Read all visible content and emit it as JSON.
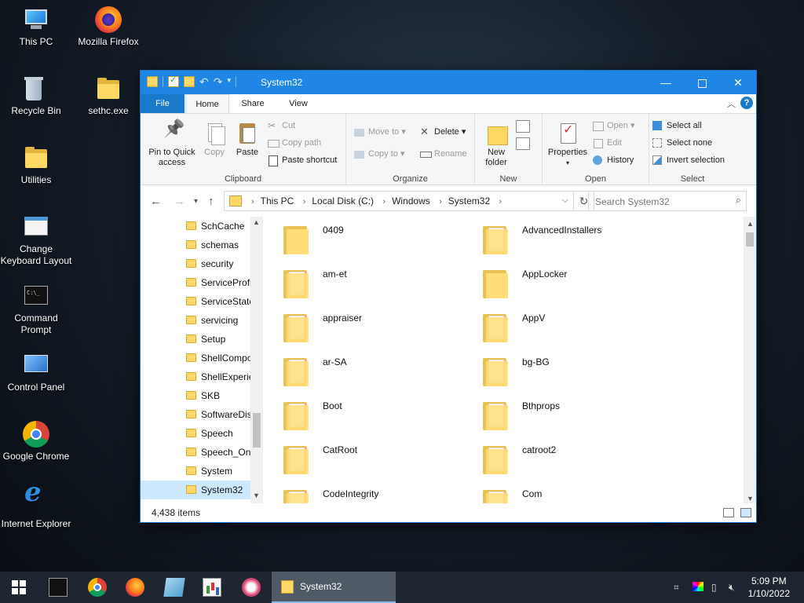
{
  "desktop": {
    "icons": [
      {
        "label": "This PC",
        "icon": "computer-icon"
      },
      {
        "label": "Mozilla Firefox",
        "icon": "firefox-icon"
      },
      {
        "label": "Recycle Bin",
        "icon": "recycle-bin-icon"
      },
      {
        "label": "sethc.exe",
        "icon": "folder-app-icon"
      },
      {
        "label": "Utilities",
        "icon": "folder-icon"
      },
      {
        "label": "Change Keyboard Layout",
        "icon": "keyboard-settings-icon"
      },
      {
        "label": "Command Prompt",
        "icon": "command-prompt-icon"
      },
      {
        "label": "Control Panel",
        "icon": "control-panel-icon"
      },
      {
        "label": "Google Chrome",
        "icon": "chrome-icon"
      },
      {
        "label": "Internet Explorer",
        "icon": "internet-explorer-icon"
      }
    ]
  },
  "window": {
    "title": "System32",
    "tabs": {
      "file": "File",
      "home": "Home",
      "share": "Share",
      "view": "View"
    },
    "ribbon": {
      "clipboard": {
        "label": "Clipboard",
        "pin": "Pin to Quick access",
        "copy": "Copy",
        "paste": "Paste",
        "cut": "Cut",
        "copy_path": "Copy path",
        "paste_shortcut": "Paste shortcut"
      },
      "organize": {
        "label": "Organize",
        "move_to": "Move to",
        "copy_to": "Copy to",
        "delete": "Delete",
        "rename": "Rename"
      },
      "new": {
        "label": "New",
        "new_folder": "New folder"
      },
      "open": {
        "label": "Open",
        "properties": "Properties",
        "open": "Open",
        "edit": "Edit",
        "history": "History"
      },
      "select": {
        "label": "Select",
        "select_all": "Select all",
        "select_none": "Select none",
        "invert_selection": "Invert selection"
      }
    },
    "address": {
      "crumbs": [
        "This PC",
        "Local Disk (C:)",
        "Windows",
        "System32"
      ]
    },
    "search": {
      "placeholder": "Search System32"
    },
    "nav_items": [
      "SchCache",
      "schemas",
      "security",
      "ServiceProfiles",
      "ServiceState",
      "servicing",
      "Setup",
      "ShellComponents",
      "ShellExperiences",
      "SKB",
      "SoftwareDistribution",
      "Speech",
      "Speech_OneCore",
      "System",
      "System32"
    ],
    "nav_selected": "System32",
    "files_left": [
      "0409",
      "am-et",
      "appraiser",
      "ar-SA",
      "Boot",
      "CatRoot",
      "CodeIntegrity"
    ],
    "files_right": [
      "AdvancedInstallers",
      "AppLocker",
      "AppV",
      "bg-BG",
      "Bthprops",
      "catroot2",
      "Com"
    ],
    "status": {
      "item_count": "4,438 items"
    }
  },
  "taskbar": {
    "active_window": "System32",
    "clock_time": "5:09 PM",
    "clock_date": "1/10/2022"
  }
}
